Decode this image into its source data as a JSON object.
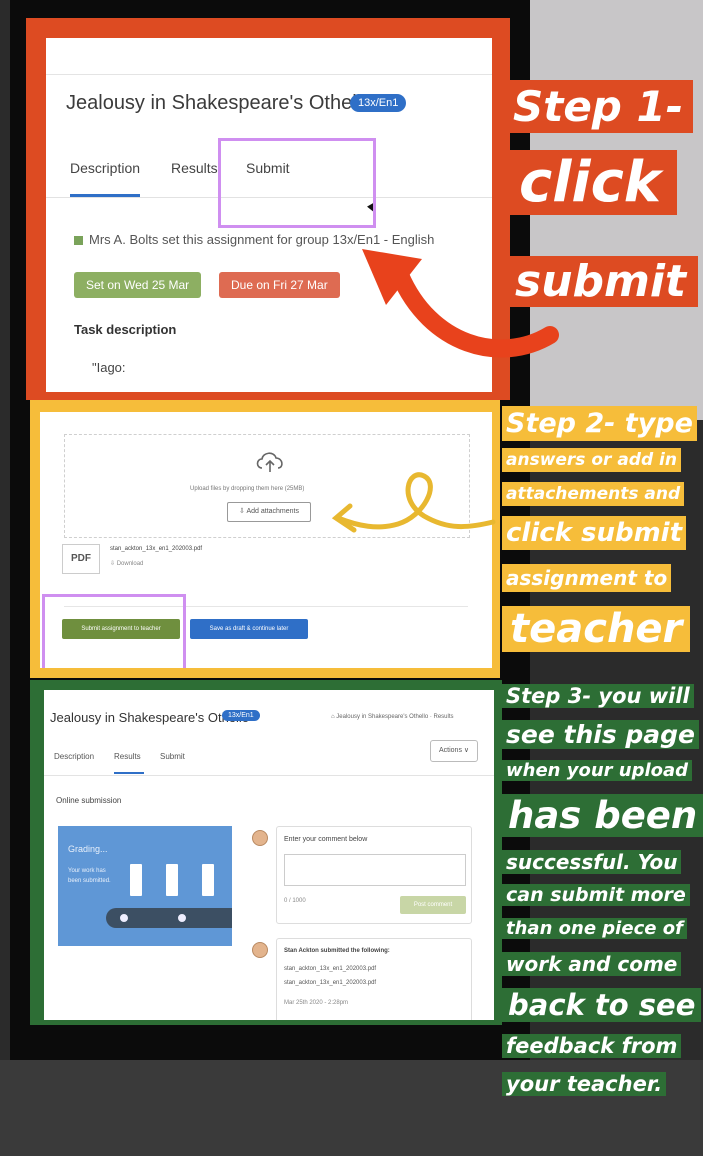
{
  "step1": {
    "assignment_title": "Jealousy in Shakespeare's Othello",
    "group_badge": "13x/En1",
    "tabs": [
      "Description",
      "Results",
      "Submit"
    ],
    "assigner_text": "Mrs A. Bolts set this assignment for group 13x/En1 - English",
    "set_date": "Set on Wed 25 Mar",
    "due_date": "Due on Fri 27 Mar",
    "task_heading": "Task description",
    "task_text": "\"Iago:",
    "caption": [
      "Step 1-",
      "click",
      "submit"
    ]
  },
  "step2": {
    "dropzone_text": "Upload files by dropping them here (25MB)",
    "add_attachments": "Add attachments",
    "file_type": "PDF",
    "file_name": "stan_ackton_13x_en1_202003.pdf",
    "download": "Download",
    "submit_button": "Submit assignment to teacher",
    "draft_button": "Save as draft & continue later",
    "caption": [
      "Step 2- type",
      "answers or add in",
      "attachements and",
      "click submit",
      "assignment to",
      "teacher"
    ]
  },
  "step3": {
    "assignment_title": "Jealousy in Shakespeare's Othello",
    "group_badge": "13x/En1",
    "breadcrumb": "Jealousy in Shakespeare's Othello · Results",
    "tabs": [
      "Description",
      "Results",
      "Submit"
    ],
    "actions": "Actions ∨",
    "online_submission": "Online submission",
    "grading_title": "Grading...",
    "grading_sub": "Your work has been submitted.",
    "comment_label": "Enter your comment below",
    "char_count": "0 / 1000",
    "post_comment": "Post comment",
    "submitted_heading": "Stan Ackton submitted the following:",
    "submitted_files": [
      "stan_ackton_13x_en1_202003.pdf",
      "stan_ackton_13x_en1_202003.pdf"
    ],
    "submitted_time": "Mar 25th 2020 - 2:28pm",
    "caption": [
      "Step 3- you will",
      "see this page",
      "when your upload",
      "has been",
      "successful. You",
      "can submit more",
      "than one piece of",
      "work and come",
      "back to see",
      "feedback from",
      "your teacher."
    ]
  },
  "colors": {
    "red": "#dd4b22",
    "yellow": "#f6bd3a",
    "green": "#2d6e35",
    "blue": "#2f6fc7",
    "highlight": "#cf8ff0"
  }
}
